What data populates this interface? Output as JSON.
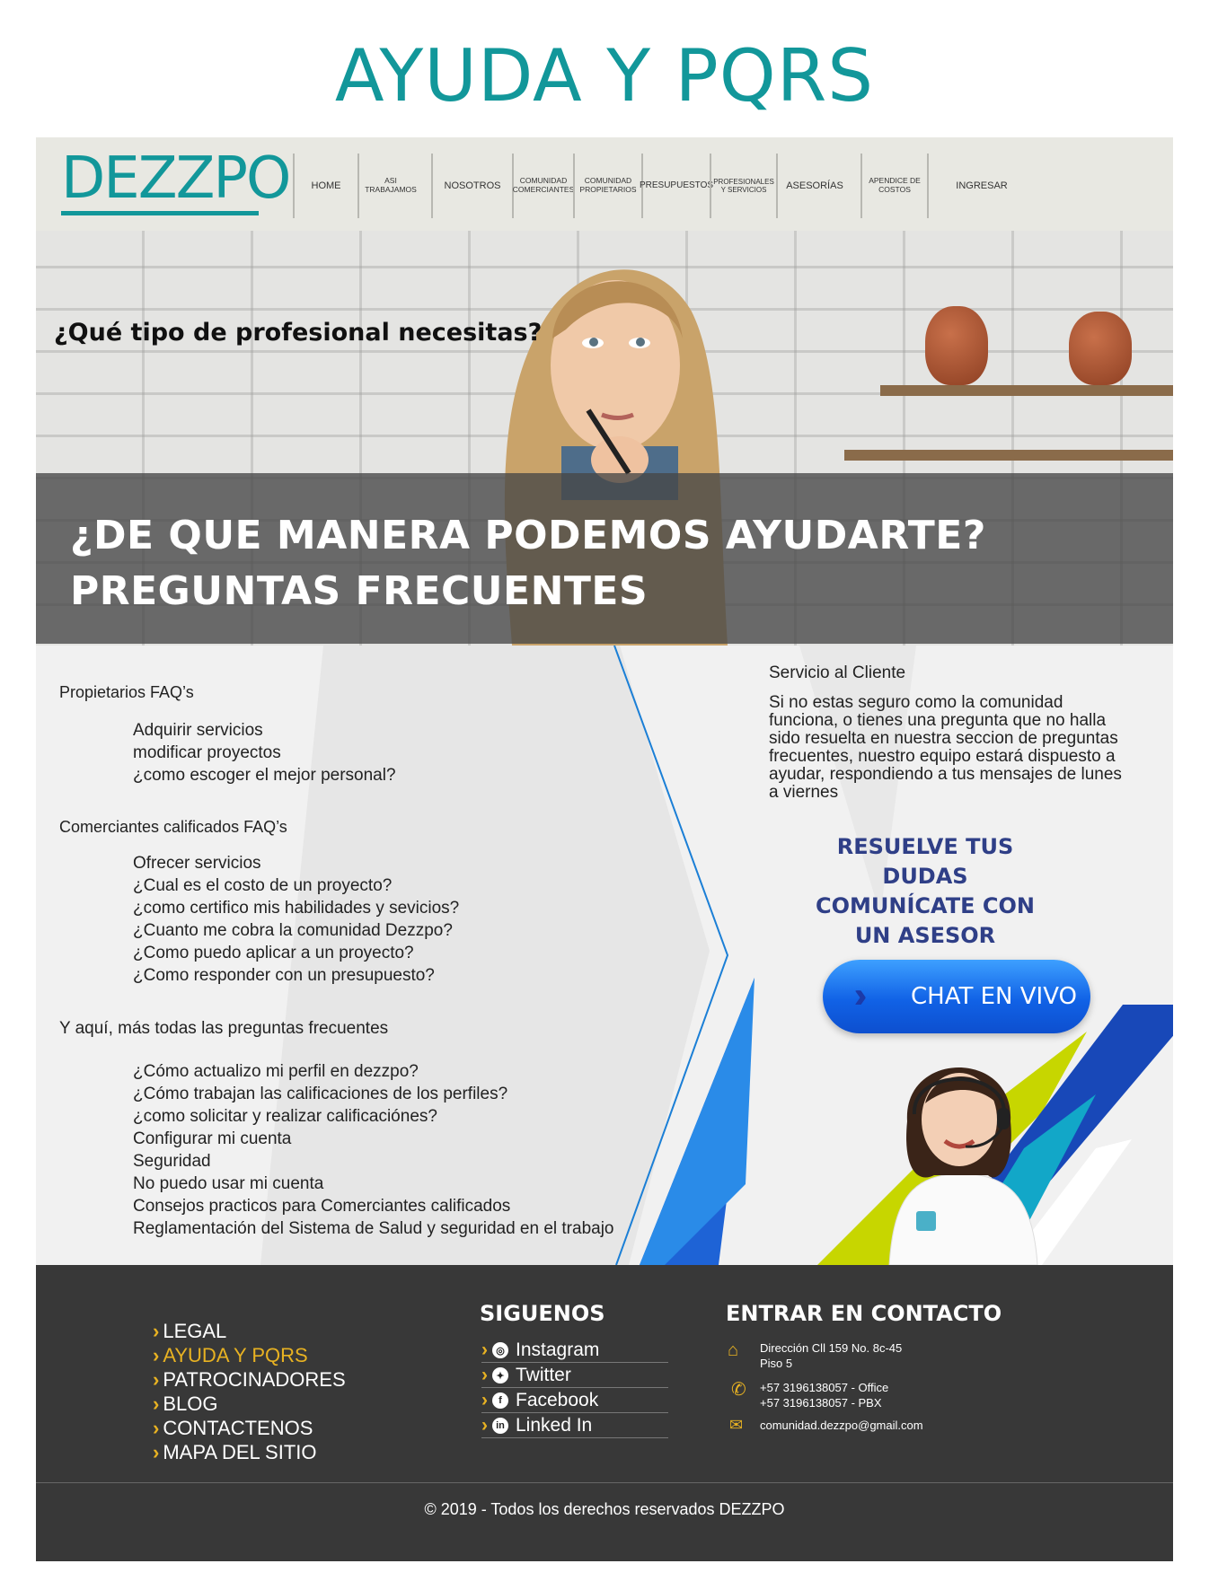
{
  "page": {
    "title": "AYUDA Y PQRS"
  },
  "brand": {
    "logo": "DEZZPO",
    "accent": "#12979a"
  },
  "nav": {
    "items": [
      {
        "label": "HOME"
      },
      {
        "label": "ASI TRABAJAMOS"
      },
      {
        "label": "NOSOTROS"
      },
      {
        "label": "COMUNIDAD COMERCIANTES"
      },
      {
        "label": "COMUNIDAD PROPIETARIOS"
      },
      {
        "label": "PRESUPUESTOS"
      },
      {
        "label": "PROFESIONALES Y SERVICIOS"
      },
      {
        "label": "ASESORÍAS"
      },
      {
        "label": "APENDICE DE COSTOS"
      },
      {
        "label": "INGRESAR"
      }
    ]
  },
  "hero": {
    "question": "¿Qué tipo de profesional necesitas?",
    "line1": "¿DE  QUE MANERA PODEMOS AYUDARTE?",
    "line2": "PREGUNTAS FRECUENTES"
  },
  "faq": {
    "propietarios": {
      "title": "Propietarios FAQ’s",
      "items": [
        "Adquirir servicios",
        "modificar proyectos",
        "¿como escoger el mejor personal?"
      ]
    },
    "comerciantes": {
      "title": "Comerciantes calificados FAQ’s",
      "items": [
        "Ofrecer servicios",
        "¿Cual es el costo de un proyecto?",
        "¿como certifico mis habilidades y sevicios?",
        "¿Cuanto me cobra la comunidad Dezzpo?",
        "¿Como puedo aplicar a un proyecto?",
        "¿Como responder con un presupuesto?"
      ]
    },
    "general": {
      "title": "Y aquí, más todas las preguntas frecuentes",
      "items": [
        "¿Cómo actualizo mi perfil en dezzpo?",
        "¿Cómo trabajan las calificaciones de los perfiles?",
        "¿como solicitar y realizar calificaciónes?",
        "Configurar mi cuenta",
        "Seguridad",
        "No puedo usar mi cuenta",
        "Consejos practicos para Comerciantes calificados",
        "Reglamentación del Sistema de Salud y seguridad en el trabajo"
      ]
    }
  },
  "service": {
    "title": "Servicio al Cliente",
    "body": "Si no estas seguro como la comunidad funciona, o tienes una pregunta que no halla sido resuelta en nuestra seccion de preguntas frecuentes, nuestro equipo estará dispuesto a ayudar, respondiendo a tus mensajes de lunes a viernes",
    "cta_line1": "RESUELVE TUS DUDAS",
    "cta_line2": "COMUNÍCATE CON",
    "cta_line3": "UN ASESOR",
    "chat_button": "CHAT EN VIVO"
  },
  "footer": {
    "links": [
      "LEGAL",
      "AYUDA Y PQRS",
      "PATROCINADORES",
      "BLOG",
      "CONTACTENOS",
      "MAPA DEL SITIO"
    ],
    "active_link": "AYUDA Y PQRS",
    "social_heading": "SIGUENOS",
    "social": [
      {
        "label": "Instagram",
        "icon": "instagram-icon"
      },
      {
        "label": "Twitter",
        "icon": "twitter-icon"
      },
      {
        "label": "Facebook",
        "icon": "facebook-icon"
      },
      {
        "label": "Linked In",
        "icon": "linkedin-icon"
      }
    ],
    "contact_heading": "ENTRAR EN CONTACTO",
    "address_line1": "Dirección  Cll 159 No. 8c-45",
    "address_line2": "Piso 5",
    "phone_office": "+57 3196138057 - Office",
    "phone_pbx": "+57 3196138057 - PBX",
    "email": "comunidad.dezzpo@gmail.com",
    "copyright": "© 2019 - Todos los derechos reservados DEZZPO"
  }
}
